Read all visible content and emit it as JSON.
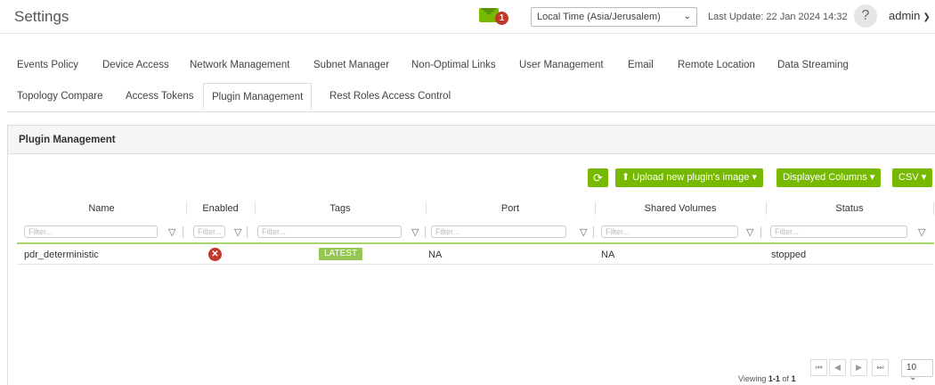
{
  "header": {
    "title": "Settings",
    "notifications_count": "1",
    "timezone": "Local Time (Asia/Jerusalem)",
    "last_update": "Last Update: 22 Jan 2024 14:32",
    "help": "?",
    "user": "admin"
  },
  "tabs": {
    "row1": [
      "Events Policy",
      "Device Access",
      "Network Management",
      "Subnet Manager",
      "Non-Optimal Links",
      "User Management",
      "Email",
      "Remote Location",
      "Data Streaming"
    ],
    "row2": [
      "Topology Compare",
      "Access Tokens",
      "Plugin Management",
      "Rest Roles Access Control"
    ],
    "active": "Plugin Management"
  },
  "panel": {
    "title": "Plugin Management",
    "toolbar": {
      "upload": "Upload new plugin's image",
      "columns": "Displayed Columns",
      "csv": "CSV"
    }
  },
  "table": {
    "columns": [
      "Name",
      "Enabled",
      "Tags",
      "Port",
      "Shared Volumes",
      "Status"
    ],
    "filter_placeholder": "Filter...",
    "rows": [
      {
        "name": "pdr_deterministic",
        "enabled": false,
        "tag": "LATEST",
        "port": "NA",
        "shared_volumes": "NA",
        "status": "stopped"
      }
    ]
  },
  "pagination": {
    "viewing_prefix": "Viewing",
    "range": "1-1",
    "of": "of",
    "total": "1",
    "page_size": "10"
  },
  "colors": {
    "accent": "#76b900",
    "danger": "#c0392b",
    "tag": "#95c653"
  }
}
